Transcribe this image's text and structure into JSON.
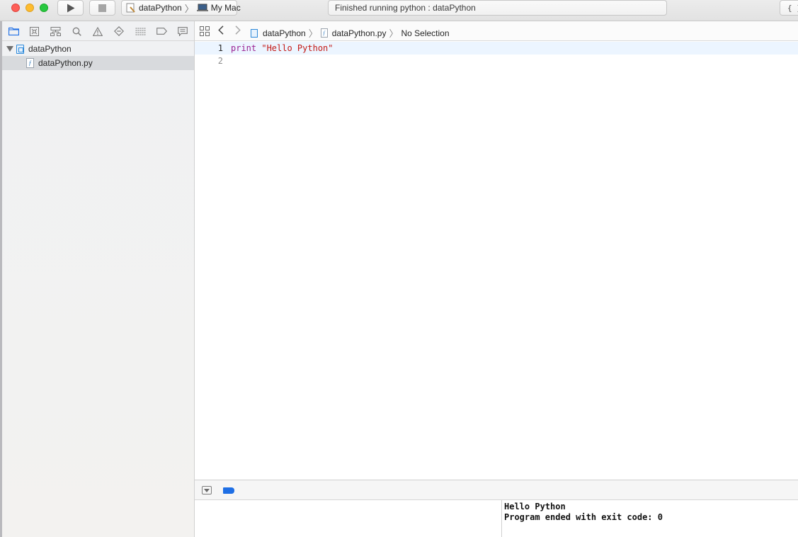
{
  "window": {
    "scheme": {
      "target": "dataPython",
      "destination": "My Mac"
    },
    "activity_status": "Finished running python : dataPython",
    "editor_mode_label": "{ }"
  },
  "navigator": {
    "tabs": [
      "project-navigator",
      "source-control-navigator",
      "symbol-navigator",
      "find-navigator",
      "issue-navigator",
      "test-navigator",
      "debug-navigator",
      "breakpoint-navigator",
      "report-navigator"
    ],
    "tree": {
      "project": "dataPython",
      "files": [
        "dataPython.py"
      ]
    }
  },
  "jumpbar": {
    "project": "dataPython",
    "file": "dataPython.py",
    "selection": "No Selection"
  },
  "editor": {
    "lines": [
      {
        "number": "1",
        "keyword": "print",
        "string": "\"Hello Python\""
      },
      {
        "number": "2"
      }
    ]
  },
  "console": {
    "output": "Hello Python\nProgram ended with exit code: 0"
  },
  "colors": {
    "keyword": "#9b2393",
    "string": "#c41a16",
    "current_line": "#ecf5ff",
    "accent": "#1f6fe5"
  }
}
